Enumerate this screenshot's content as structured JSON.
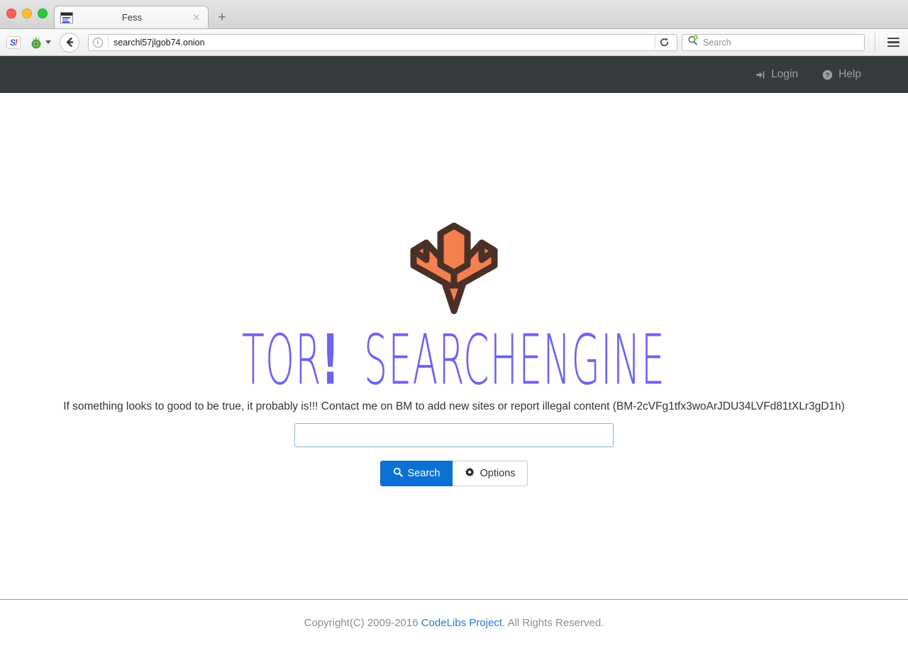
{
  "browser": {
    "window_controls": [
      "close",
      "minimize",
      "maximize"
    ],
    "tab": {
      "title": "Fess",
      "close_label": "✕",
      "favicon_name": "page-favicon"
    },
    "new_tab_label": "+",
    "toolbar": {
      "yahoo_label": "S",
      "yahoo_bang": "!",
      "back_label": "Back",
      "url": "searchl57jlgob74.onion",
      "info_label": "i",
      "reload_label": "Reload",
      "search_placeholder": "Search",
      "menu_label": "Menu"
    }
  },
  "topnav": {
    "login_label": "Login",
    "help_label": "Help"
  },
  "main": {
    "logo_name": "fess-logo",
    "brand_part1": "TOR",
    "brand_bang": "!",
    "brand_part2": "SEARCHENGINE",
    "tagline": "If something looks to good to be true, it probably is!!! Contact me on BM to add new sites or report illegal content (BM-2cVFg1tfx3woArJDU34LVFd81tXLr3gD1h)",
    "search_value": "",
    "search_placeholder": "",
    "search_button_label": "Search",
    "options_button_label": "Options"
  },
  "footer": {
    "prefix": "Copyright(C) 2009-2016 ",
    "link": "CodeLibs Project",
    "suffix": ". All Rights Reserved."
  },
  "colors": {
    "topnav_bg": "#363b3e",
    "brand": "#6c63f0",
    "logo_fill": "#f5804f",
    "logo_stroke": "#4a3027",
    "primary_button": "#0b72d4",
    "link": "#2876d4"
  }
}
